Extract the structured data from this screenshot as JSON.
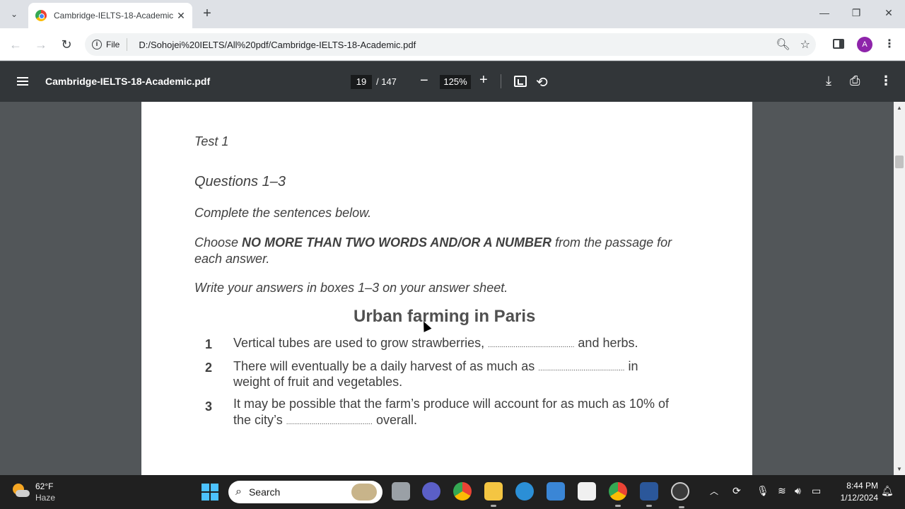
{
  "browser": {
    "tab_title": "Cambridge-IELTS-18-Academic",
    "tab_close": "✕",
    "new_tab": "+",
    "window": {
      "minimize": "—",
      "restore": "❐",
      "close": "✕"
    },
    "nav": {
      "back": "←",
      "forward": "→",
      "reload": "↻"
    },
    "omnibox": {
      "chip": "File",
      "url": "D:/Sohojei%20IELTS/All%20pdf/Cambridge-IELTS-18-Academic.pdf"
    },
    "avatar_letter": "A"
  },
  "pdf_toolbar": {
    "doc_name": "Cambridge-IELTS-18-Academic.pdf",
    "page_current": "19",
    "page_total": "/ 147",
    "zoom": "125%",
    "zoom_out": "−",
    "zoom_in": "+"
  },
  "document": {
    "test_label": "Test 1",
    "questions_heading": "Questions 1–3",
    "instruction1": "Complete the sentences below.",
    "instruction2_pre": "Choose ",
    "instruction2_bold": "NO MORE THAN TWO WORDS AND/OR A NUMBER",
    "instruction2_post": " from the passage for",
    "instruction2_line2": "each answer.",
    "instruction3": "Write your answers in boxes 1–3 on your answer sheet.",
    "passage_title": "Urban farming in Paris",
    "questions": [
      {
        "num": "1",
        "line1_pre": "Vertical tubes are used to grow strawberries, ",
        "blank": "............................................",
        "line1_post": " and herbs.",
        "line2": ""
      },
      {
        "num": "2",
        "line1_pre": "There will eventually be a daily harvest of as much as ",
        "blank": "............................................",
        "line1_post": " in",
        "line2": "weight of fruit and vegetables."
      },
      {
        "num": "3",
        "line1_pre": "It may be possible that the farm’s produce will account for as much as 10% of",
        "blank": "",
        "line1_post": "",
        "line2_pre": "the city’s ",
        "line2_blank": "............................................",
        "line2_post": " overall."
      }
    ]
  },
  "taskbar": {
    "temperature": "62°F",
    "condition": "Haze",
    "search_label": "Search",
    "time": "8:44 PM",
    "date": "1/12/2024"
  },
  "colors": {
    "accent_avatar": "#8e24aa",
    "pdf_toolbar_bg": "#323639",
    "viewer_bg": "#525659"
  }
}
